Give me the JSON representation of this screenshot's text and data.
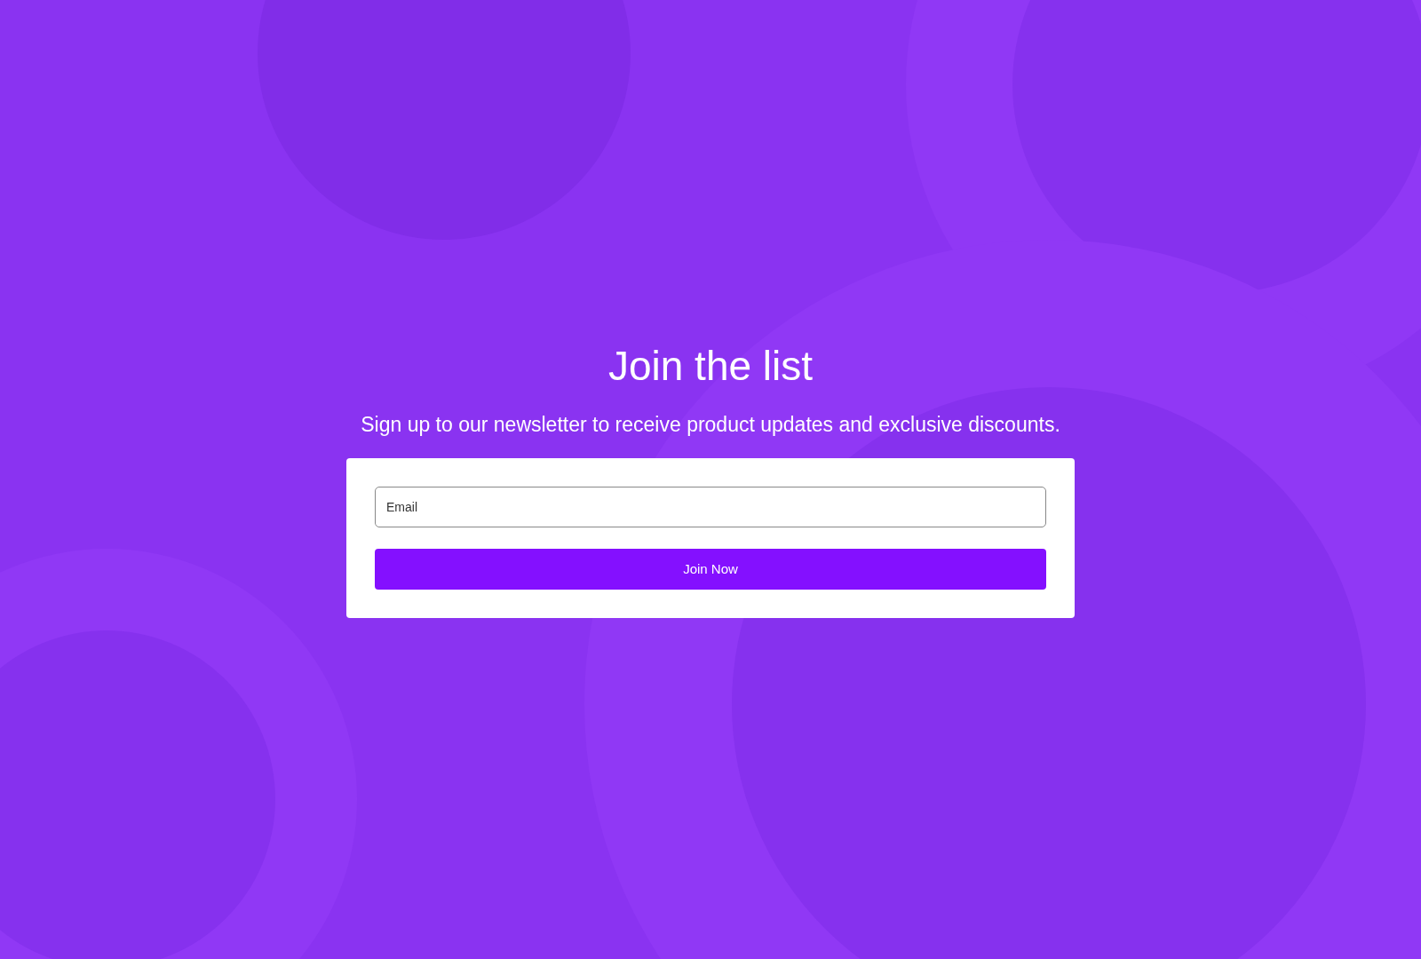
{
  "heading": "Join the list",
  "subheading": "Sign up to our newsletter to receive product updates and exclusive discounts.",
  "form": {
    "email": {
      "placeholder": "Email"
    },
    "submit": "Join Now"
  }
}
